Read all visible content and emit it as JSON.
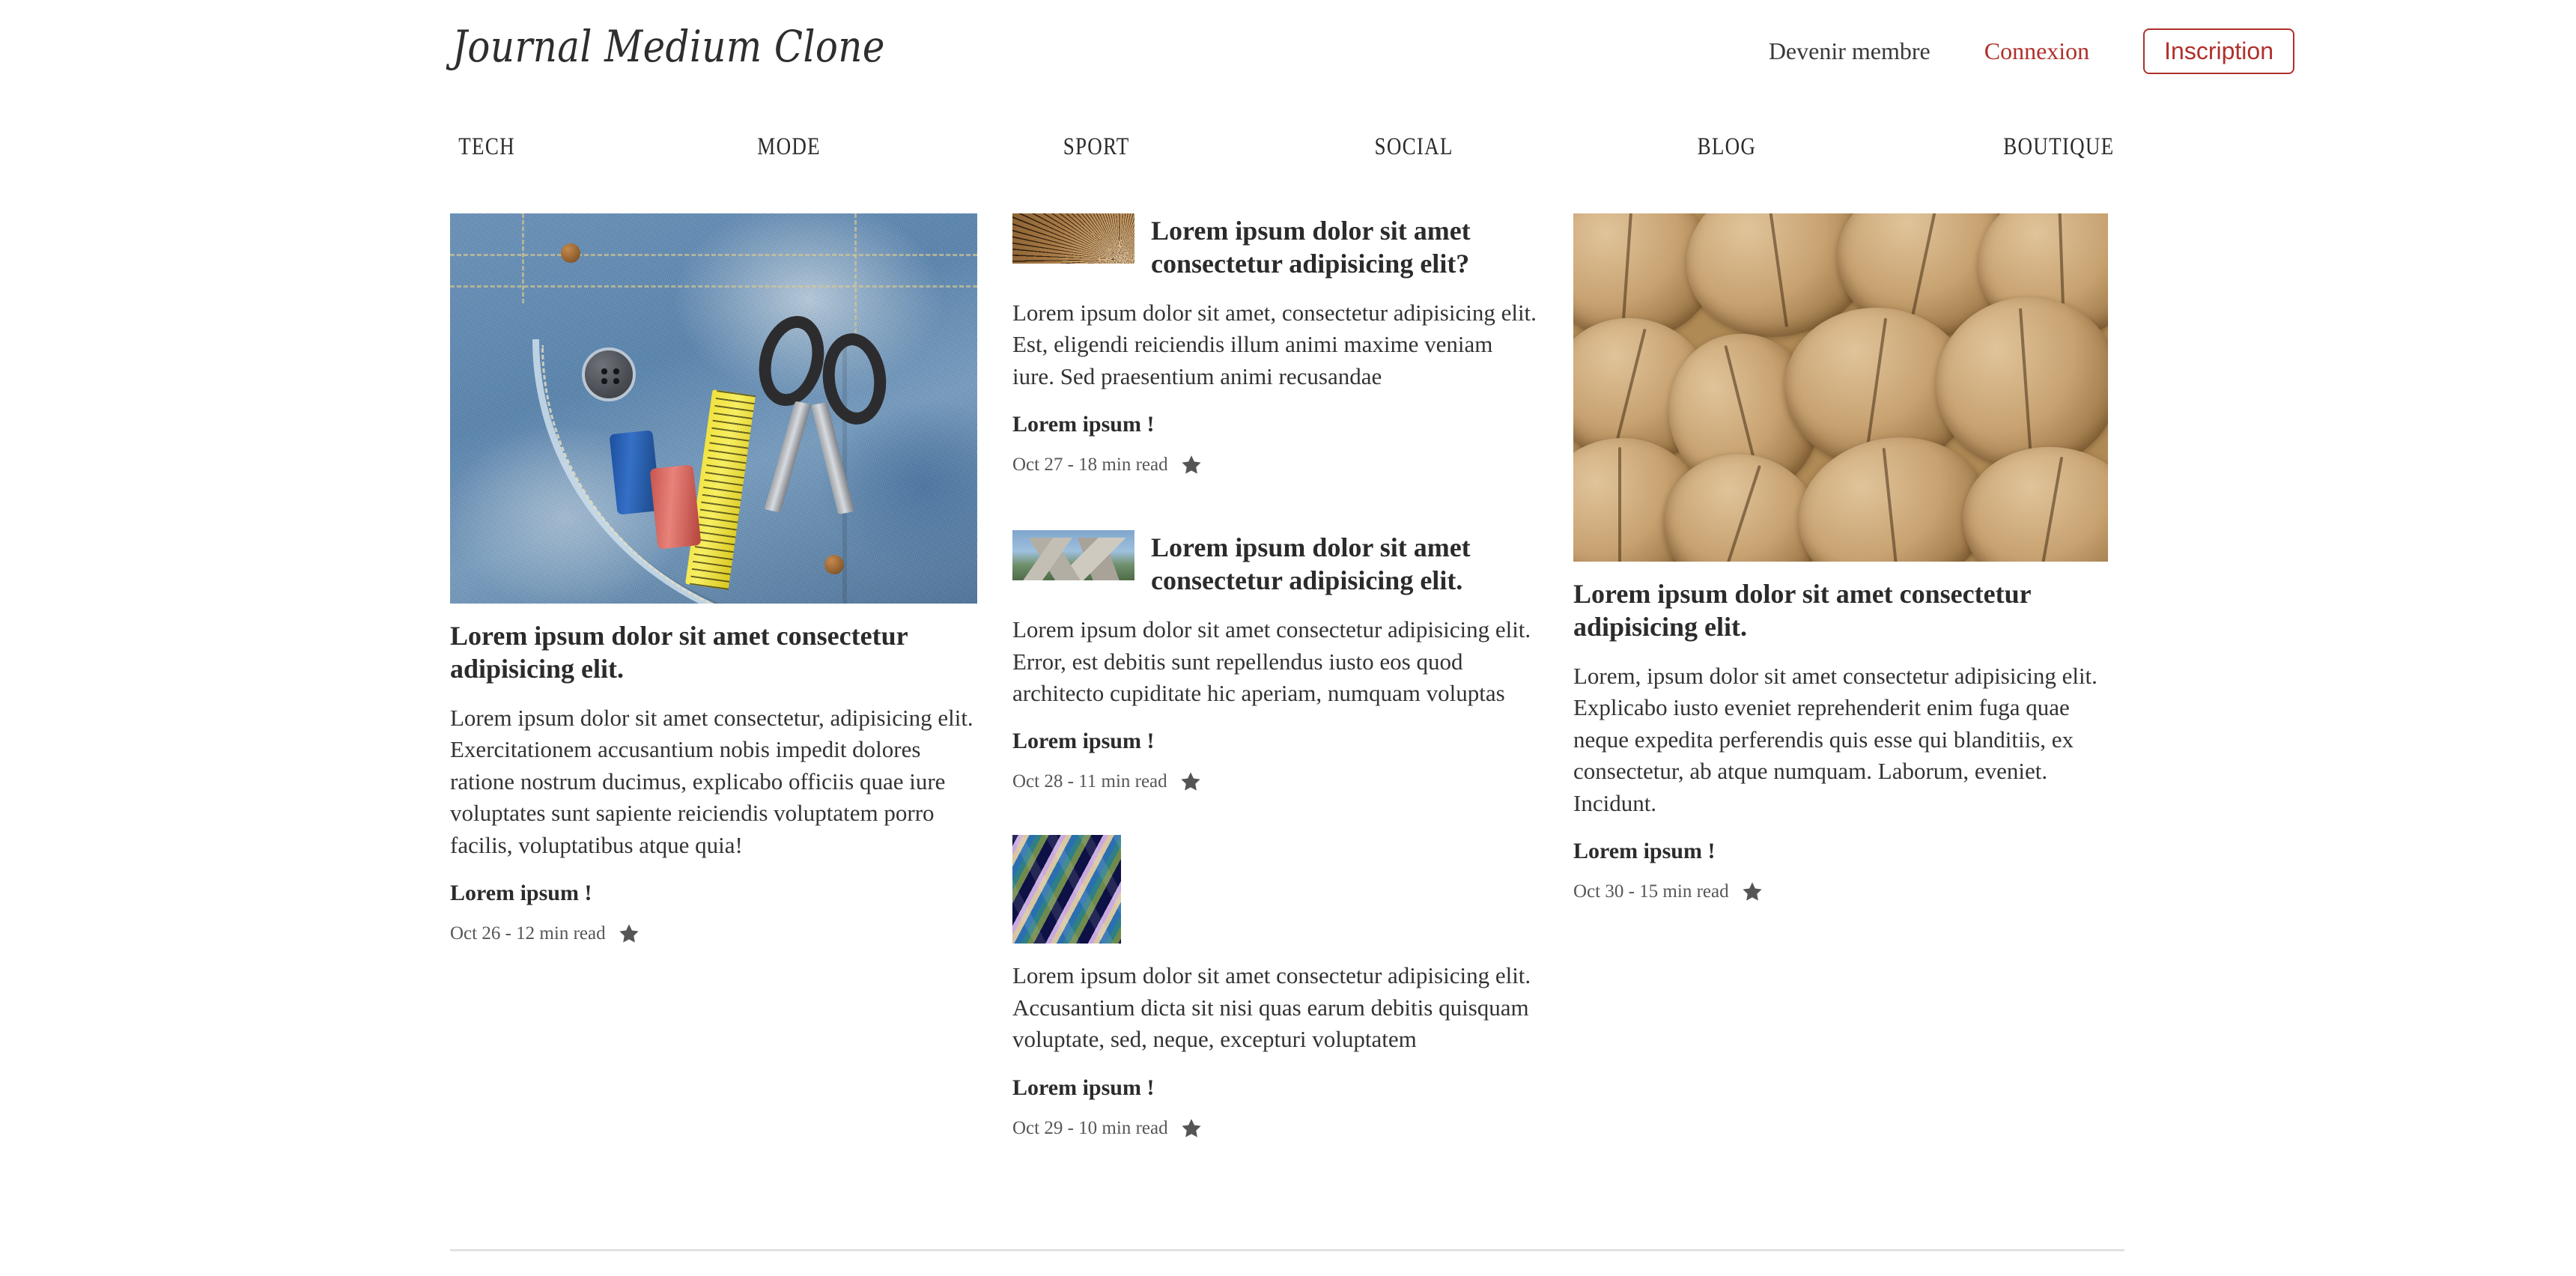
{
  "header": {
    "brand": "Journal Medium Clone",
    "member_link": "Devenir membre",
    "login_link": "Connexion",
    "signup_button": "Inscription",
    "accent_color": "#b0302b"
  },
  "nav": {
    "items": [
      {
        "label": "TECH"
      },
      {
        "label": "MODE"
      },
      {
        "label": "SPORT"
      },
      {
        "label": "SOCIAL"
      },
      {
        "label": "BLOG"
      },
      {
        "label": "BOUTIQUE"
      }
    ]
  },
  "featured": {
    "image_alt": "denim-pocket-sewing-kit",
    "title": "Lorem ipsum dolor sit amet consectetur adipisicing elit.",
    "excerpt": "Lorem ipsum dolor sit amet consectetur, adipisicing elit. Exercitationem accusantium nobis impedit dolores ratione nostrum ducimus, explicabo officiis quae iure voluptates sunt sapiente reiciendis voluptatem porro facilis, voluptatibus atque quia!",
    "tagline": "Lorem ipsum !",
    "meta": "Oct 26 - 12 min read"
  },
  "middle_articles": [
    {
      "image_alt": "wood-cross-section",
      "title": "Lorem ipsum dolor sit amet consectetur adipisicing elit?",
      "excerpt": "Lorem ipsum dolor sit amet, consectetur adipisicing elit. Est, eligendi reiciendis illum animi maxime veniam iure. Sed praesentium animi recusandae",
      "tagline": "Lorem ipsum !",
      "meta": "Oct 27 - 18 min read"
    },
    {
      "image_alt": "mount-rushmore",
      "title": "Lorem ipsum dolor sit amet consectetur adipisicing elit.",
      "excerpt": "Lorem ipsum dolor sit amet consectetur adipisicing elit. Error, est debitis sunt repellendus iusto eos quod architecto cupiditate hic aperiam, numquam voluptas",
      "tagline": "Lorem ipsum !",
      "meta": "Oct 28 - 11 min read"
    },
    {
      "image_alt": "abstract-wavy-stripes",
      "title": "",
      "excerpt": "Lorem ipsum dolor sit amet consectetur adipisicing elit. Accusantium dicta sit nisi quas earum debitis quisquam voluptate, sed, neque, excepturi voluptatem",
      "tagline": "Lorem ipsum !",
      "meta": "Oct 29 - 10 min read"
    }
  ],
  "right_article": {
    "image_alt": "walnuts-pile",
    "title": "Lorem ipsum dolor sit amet consectetur adipisicing elit.",
    "excerpt": "Lorem, ipsum dolor sit amet consectetur adipisicing elit. Explicabo iusto eveniet reprehenderit enim fuga quae neque expedita perferendis quis esse qui blanditiis, ex consectetur, ab atque numquam. Laborum, eveniet. Incidunt.",
    "tagline": "Lorem ipsum !",
    "meta": "Oct 30 - 15 min read"
  },
  "icons": {
    "star": "star-icon"
  }
}
